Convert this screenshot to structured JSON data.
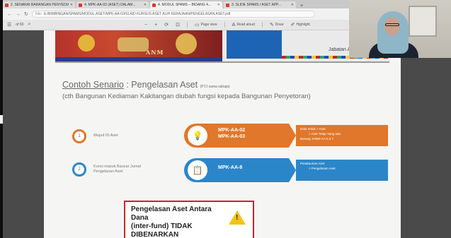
{
  "browser": {
    "tabs": [
      {
        "title": "2. SENARAI BARANGAN PENYEDIA..."
      },
      {
        "title": "4. MPK-AA-03 (ASET) DALAM..."
      },
      {
        "title": "4. MODUL SPAMS – BIDANG 4...",
        "active": true
      },
      {
        "title": "3. SLIDE SPAMS / ASET APP..."
      }
    ],
    "url": "E:/BIMBINGAN/SPAMS/MODUL ASET/MPK-AA-03/SLAID KURSUS ASET ALIH KERAJAAN/PENGELASAN ASET.pdf",
    "url_info": "File"
  },
  "pdf_toolbar": {
    "page_label": "of 60",
    "page_view": "Page view",
    "read_aloud": "Read aloud",
    "draw": "Draw",
    "highlight": "Highlight"
  },
  "previous_slide": {
    "logo_text": "ANM",
    "caption": "Jabatan A..."
  },
  "slide": {
    "title_prefix": "Contoh Senario",
    "title_rest": " : Pengelasan Aset ",
    "title_note": "(PTJ sama sahaja)",
    "subtitle": "(cth Bangunan Kediaman Kakitangan diubah fungsi kepada Bangunan Penyetoran)",
    "steps": [
      {
        "num": "1",
        "text": "Wujud ID Aset",
        "ring_color": "#e0772a"
      },
      {
        "num": "2",
        "text": "Kunci masuk Baucar Jurnal Pengelasan Aset",
        "ring_color": "#2b86c9"
      }
    ],
    "bands": [
      {
        "icon": "lightbulb-icon",
        "codes": [
          "MPK-AA-02",
          "MPK-AA-03"
        ],
        "color": "#e0772a",
        "details": [
          "Data Induk > Aset",
          "> Aset Tetap Yang ada",
          "Borang JANM-AA-0.3 ?"
        ]
      },
      {
        "icon": "document-icon",
        "codes": [
          "MPK-AA-8"
        ],
        "color": "#2b86c9",
        "details": [
          "Perakaunan Aset",
          "> Pengelasan Aset"
        ]
      }
    ],
    "warning": {
      "text_lines": [
        "Pengelasan Aset Antara",
        "Dana",
        "(inter-fund) TIDAK",
        "DIBENARKAN"
      ],
      "icon": "warning-triangle-icon"
    }
  },
  "webcam": {
    "participant": "presenter-video"
  },
  "colors": {
    "orange": "#e0772a",
    "blue": "#2b86c9",
    "warning_red": "#c8242c",
    "warning_yellow": "#f2c318"
  }
}
